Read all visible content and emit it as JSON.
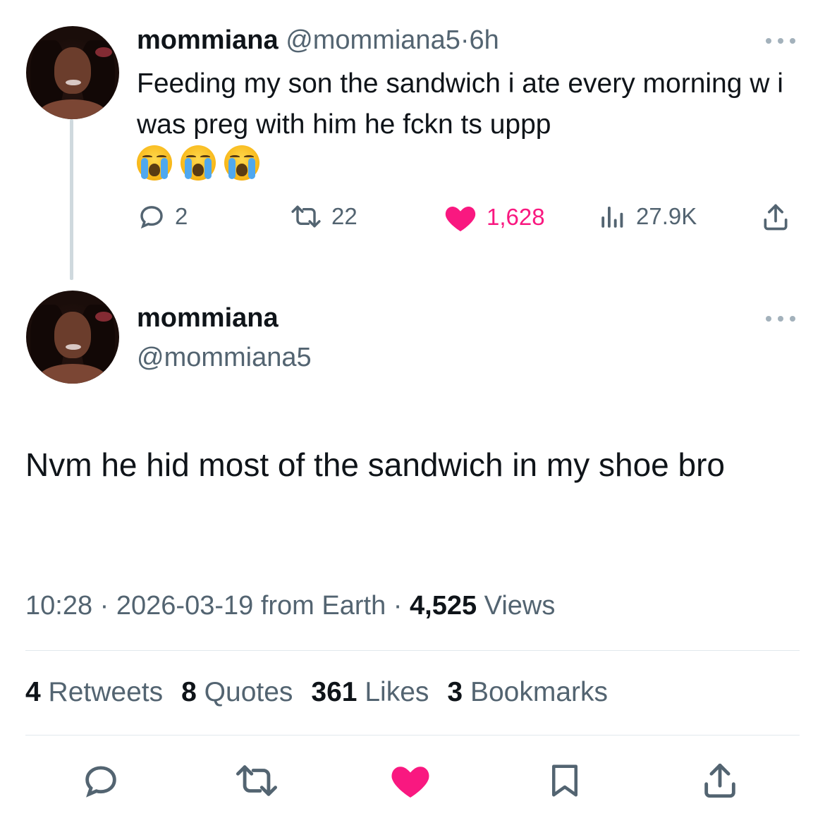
{
  "tweet1": {
    "display_name": "mommiana",
    "handle": "@mommiana5",
    "separator": "·",
    "time": "6h",
    "text": "Feeding my son the sandwich i ate every morning w i was preg with him he fckn ts uppp",
    "emojis": [
      "loudly-crying-face",
      "loudly-crying-face",
      "loudly-crying-face"
    ],
    "replies": "2",
    "retweets": "22",
    "likes": "1,628",
    "views": "27.9K"
  },
  "tweet2": {
    "display_name": "mommiana",
    "handle": "@mommiana5",
    "text": "Nvm he hid most of the sandwich in my shoe bro",
    "timestamp": "10:28",
    "date": "2026-03-19",
    "source": "from Earth",
    "separator": "·",
    "views_count": "4,525",
    "views_label": "Views",
    "stats": {
      "retweets_count": "4",
      "retweets_label": "Retweets",
      "quotes_count": "8",
      "quotes_label": "Quotes",
      "likes_count": "361",
      "likes_label": "Likes",
      "bookmarks_count": "3",
      "bookmarks_label": "Bookmarks"
    }
  },
  "colors": {
    "text": "#0f1419",
    "muted": "#536471",
    "like": "#f91880",
    "divider": "#e1e8ed",
    "thread_line": "#cfd9de"
  }
}
